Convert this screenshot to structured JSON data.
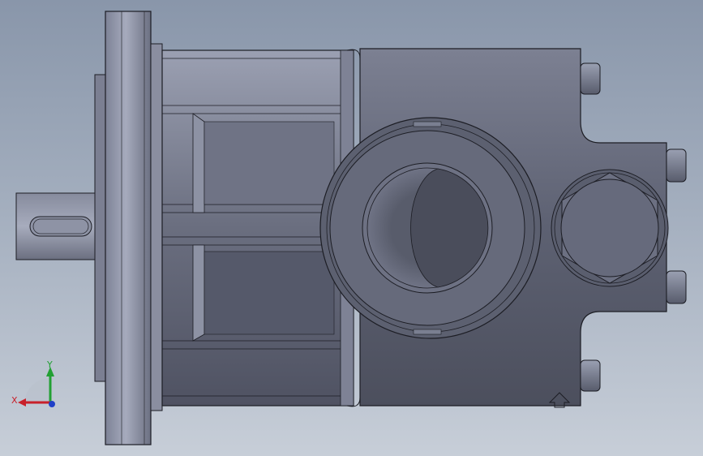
{
  "viewport": {
    "background_top": "#8996aa",
    "background_bottom": "#c7ced8"
  },
  "triad": {
    "x_label": "X",
    "y_label": "Y",
    "x_color": "#c8202a",
    "y_color": "#22a033",
    "z_color": "#2040c8"
  },
  "model": {
    "body_color": "#5a5e6e",
    "edge_color": "#1c1d24"
  }
}
